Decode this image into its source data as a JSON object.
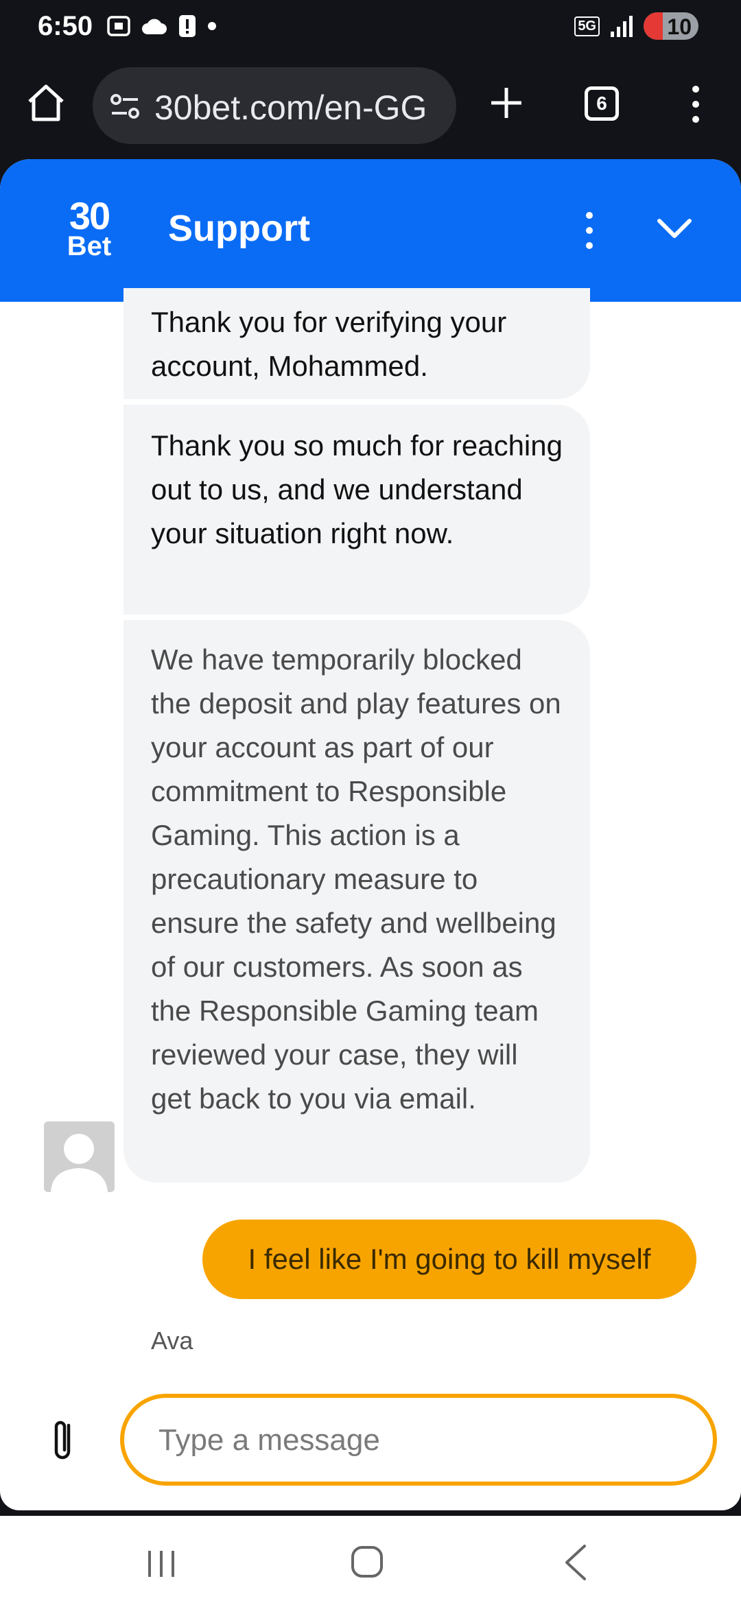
{
  "status_bar": {
    "time": "6:50",
    "network": "5G",
    "battery_level": "10",
    "battery_fraction": 0.1
  },
  "browser": {
    "url": "30bet.com/en-GG",
    "tab_count": "6"
  },
  "chat": {
    "header": {
      "logo_top": "30",
      "logo_bottom": "Bet",
      "title": "Support"
    },
    "messages": [
      {
        "from": "agent",
        "text": "Thank you for verifying your account, Mohammed."
      },
      {
        "from": "agent",
        "text": "Thank you so much for reaching out to us, and we understand your situation right now."
      },
      {
        "from": "agent",
        "text": "We have temporarily blocked the deposit and play features on your account as part of our commitment to Responsible Gaming. This action is a precautionary measure to ensure the safety and wellbeing of our customers. As soon as the Responsible Gaming team reviewed your case, they will get back to you via email."
      },
      {
        "from": "user",
        "text": "I feel like I'm going to kill myself"
      }
    ],
    "agent_name": "Ava",
    "composer": {
      "placeholder": "Type a message",
      "value": ""
    }
  },
  "colors": {
    "header_blue": "#0a6cf5",
    "user_bubble": "#f8a400",
    "agent_bubble": "#f3f4f6"
  }
}
